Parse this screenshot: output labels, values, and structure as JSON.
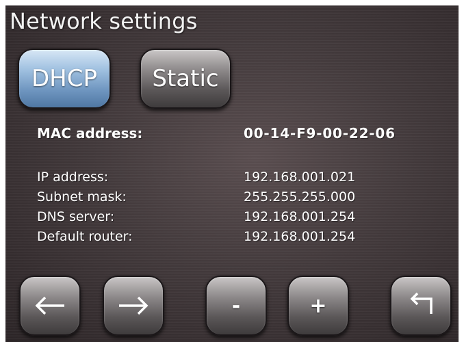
{
  "header": {
    "title": "Network settings"
  },
  "mode": {
    "options": [
      {
        "label": "DHCP",
        "selected": true
      },
      {
        "label": "Static",
        "selected": false
      }
    ]
  },
  "mac": {
    "label": "MAC address:",
    "value": "00-14-F9-00-22-06"
  },
  "fields": [
    {
      "label": "IP address:",
      "value": "192.168.001.021"
    },
    {
      "label": "Subnet mask:",
      "value": "255.255.255.000"
    },
    {
      "label": "DNS server:",
      "value": "192.168.001.254"
    },
    {
      "label": "Default router:",
      "value": "192.168.001.254"
    }
  ],
  "controls": {
    "minus_label": "-",
    "plus_label": "+",
    "icons": [
      "arrow-left-icon",
      "arrow-right-icon",
      "enter-icon"
    ]
  },
  "colors": {
    "selected_button": "#8fb3d9",
    "button_gray": "#6f6b6c",
    "background": "#433a3c"
  }
}
